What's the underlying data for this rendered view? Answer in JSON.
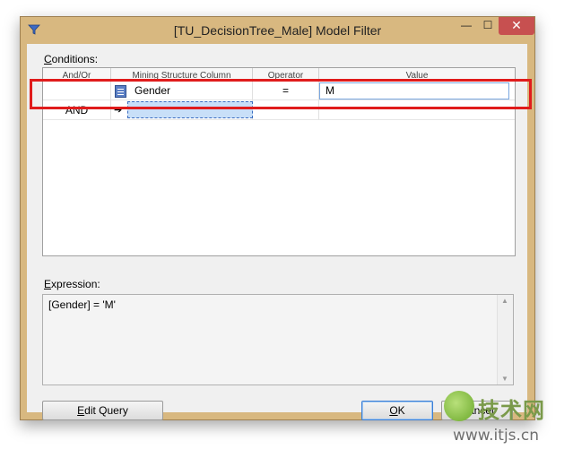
{
  "window": {
    "title": "[TU_DecisionTree_Male] Model Filter",
    "controls": {
      "minimize": "—",
      "maximize": "☐",
      "close": "✕"
    }
  },
  "conditions": {
    "label_prefix": "C",
    "label_rest": "onditions:",
    "columns": [
      "And/Or",
      "Mining Structure Column",
      "Operator",
      "Value"
    ],
    "rows": [
      {
        "and_or": "",
        "column": "Gender",
        "operator": "=",
        "value": "M"
      },
      {
        "and_or": "AND",
        "column": "",
        "operator": "",
        "value": "",
        "pointer": "➔"
      }
    ]
  },
  "expression": {
    "label_prefix": "E",
    "label_rest": "xpression:",
    "text": "[Gender] = 'M'"
  },
  "buttons": {
    "edit_query_prefix": "E",
    "edit_query_rest": "dit Query",
    "ok_prefix": "O",
    "ok_rest": "K",
    "cancel": "Cancel"
  },
  "watermark": {
    "brand": "技术网",
    "url": "www.itjs.cn"
  }
}
